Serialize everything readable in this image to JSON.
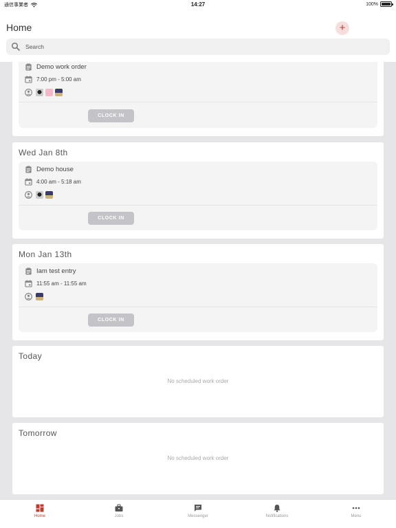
{
  "status_bar": {
    "carrier": "通信事業者",
    "time": "14:27",
    "battery": "100%"
  },
  "header": {
    "title": "Home",
    "add_symbol": "+"
  },
  "search": {
    "placeholder": "Search"
  },
  "day_cards": [
    {
      "title": "",
      "entry": {
        "name": "Demo work order",
        "time": "7:00 pm - 5:00 am",
        "clock_label": "CLOCK IN"
      }
    },
    {
      "title": "Wed Jan 8th",
      "entry": {
        "name": "Demo house",
        "time": "4:00 am - 5:18 am",
        "clock_label": "CLOCK IN"
      }
    },
    {
      "title": "Mon Jan 13th",
      "entry": {
        "name": "Iam test entry",
        "time": "11:55 am - 11:55 am",
        "clock_label": "CLOCK IN"
      }
    }
  ],
  "empty_cards": [
    {
      "title": "Today",
      "message": "No scheduled work order"
    },
    {
      "title": "Tomorrow",
      "message": "No scheduled work order"
    }
  ],
  "tabs": [
    {
      "label": "Home",
      "icon": "home-grid-icon",
      "active": true
    },
    {
      "label": "Jobs",
      "icon": "briefcase-icon",
      "active": false
    },
    {
      "label": "Messenger",
      "icon": "chat-icon",
      "active": false
    },
    {
      "label": "Notifications",
      "icon": "bell-icon",
      "active": false
    },
    {
      "label": "Menu",
      "icon": "more-dots-icon",
      "active": false
    }
  ],
  "colors": {
    "accent": "#c0392b",
    "background": "#e6e6e8",
    "button_disabled": "#c4c4c8"
  }
}
